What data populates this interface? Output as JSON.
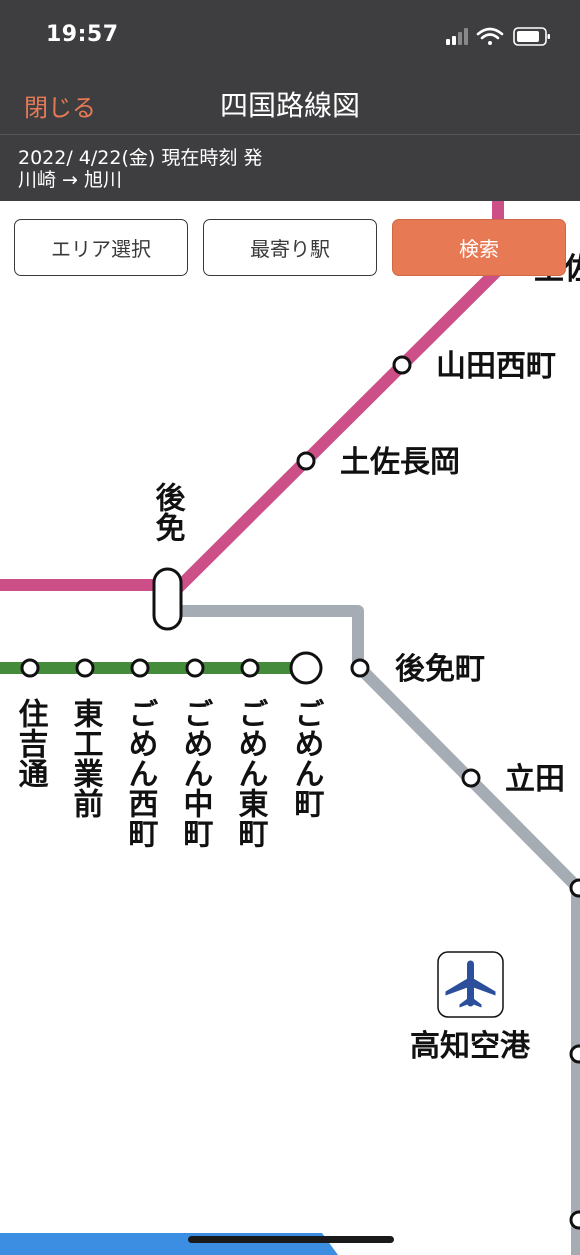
{
  "status": {
    "time": "19:57"
  },
  "nav": {
    "close_label": "閉じる",
    "title": "四国路線図"
  },
  "info": {
    "line1": "2022/ 4/22(金) 現在時刻 発",
    "line2": "川崎 → 旭川"
  },
  "buttons": {
    "area": "エリア選択",
    "nearest": "最寄り駅",
    "search": "検索"
  },
  "colors": {
    "pink_line": "#cc4f88",
    "gray_line": "#a5acb3",
    "green_line": "#448c3c",
    "blue_line": "#3c8ee3",
    "accent": "#e77a55",
    "header_bg": "#3e3e40",
    "airport_icon": "#2b4f9a"
  },
  "stations": {
    "partial_top_right": "土佐",
    "yamada_nishimachi": "山田西町",
    "tosa_nagaoka": "土佐長岡",
    "gomen": "後免",
    "gomen_machi_gray": "後免町",
    "tateda": "立田",
    "sumiyoshi_dori": "住吉通",
    "higashi_kogyo_mae": "東工業前",
    "gomen_nishimachi": "ごめん西町",
    "gomen_nakamachi": "ごめん中町",
    "gomen_higashimachi": "ごめん東町",
    "gomen_machi": "ごめん町"
  },
  "airport": {
    "label": "高知空港",
    "icon": "airplane-icon"
  }
}
